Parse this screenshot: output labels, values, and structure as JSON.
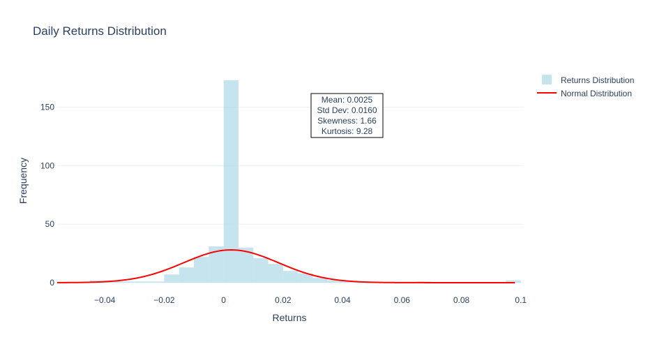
{
  "chart_data": {
    "type": "bar",
    "title": "Daily Returns Distribution",
    "xlabel": "Returns",
    "ylabel": "Frequency",
    "xlim": [
      -0.056,
      0.101
    ],
    "ylim": [
      -6,
      182
    ],
    "x_ticks": [
      -0.04,
      -0.02,
      0,
      0.02,
      0.04,
      0.06,
      0.08,
      0.1
    ],
    "x_tick_labels": [
      "−0.04",
      "−0.02",
      "0",
      "0.02",
      "0.04",
      "0.06",
      "0.08",
      "0.1"
    ],
    "y_ticks": [
      0,
      50,
      100,
      150
    ],
    "y_tick_labels": [
      "0",
      "50",
      "100",
      "150"
    ],
    "grid": true,
    "legend_position": "top-right",
    "series": [
      {
        "name": "Returns Distribution",
        "kind": "histogram",
        "color": "#add8e6",
        "opacity": 0.7,
        "bin_width": 0.005,
        "bins": [
          {
            "x0": -0.045,
            "value": 2
          },
          {
            "x0": -0.04,
            "value": 2
          },
          {
            "x0": -0.035,
            "value": 1
          },
          {
            "x0": -0.03,
            "value": 1
          },
          {
            "x0": -0.025,
            "value": 1
          },
          {
            "x0": -0.02,
            "value": 7
          },
          {
            "x0": -0.015,
            "value": 13
          },
          {
            "x0": -0.01,
            "value": 22
          },
          {
            "x0": -0.005,
            "value": 31
          },
          {
            "x0": 0.0,
            "value": 173
          },
          {
            "x0": 0.005,
            "value": 30
          },
          {
            "x0": 0.01,
            "value": 21
          },
          {
            "x0": 0.015,
            "value": 16
          },
          {
            "x0": 0.02,
            "value": 10
          },
          {
            "x0": 0.025,
            "value": 8
          },
          {
            "x0": 0.03,
            "value": 4
          },
          {
            "x0": 0.035,
            "value": 2
          },
          {
            "x0": 0.04,
            "value": 1
          },
          {
            "x0": 0.045,
            "value": 1
          },
          {
            "x0": 0.065,
            "value": 1
          },
          {
            "x0": 0.095,
            "value": 2
          }
        ]
      },
      {
        "name": "Normal Distribution",
        "kind": "line",
        "color": "#ff0000",
        "mean": 0.0025,
        "std": 0.016,
        "peak": 28
      }
    ],
    "annotation": {
      "lines": [
        "Mean: 0.0025",
        "Std Dev: 0.0160",
        "Skewness: 1.66",
        "Kurtosis: 9.28"
      ]
    }
  }
}
